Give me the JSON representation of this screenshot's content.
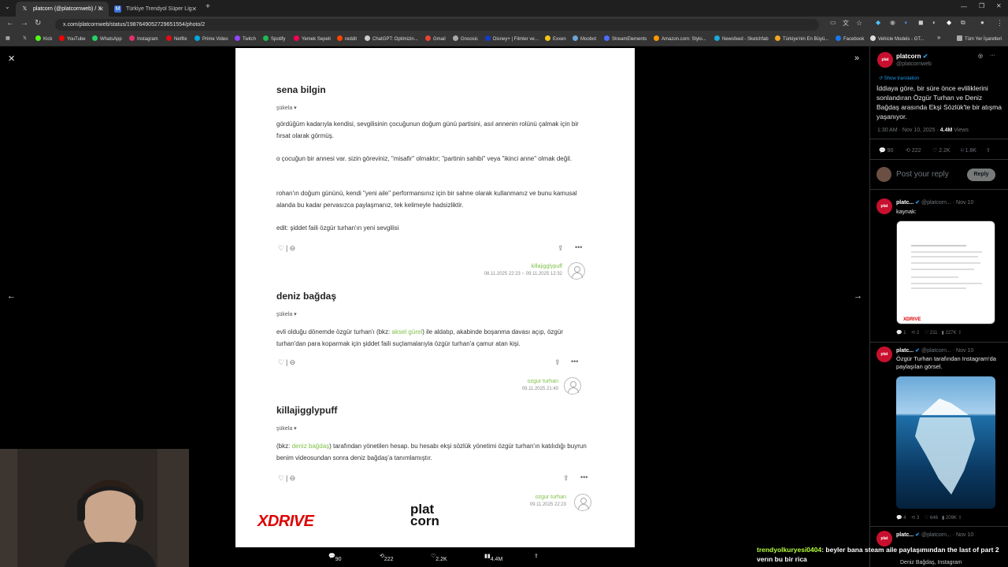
{
  "browser": {
    "tabs": [
      {
        "title": "platcorn (@platcornweb) / X",
        "active": true
      },
      {
        "title": "Türkiye Trendyol Süper Lig - 20",
        "active": false
      }
    ],
    "url": "x.com/platcornweb/status/1987649052729651554/photo/2",
    "bookmarks": [
      "Kick",
      "YouTube",
      "WhatsApp",
      "Instagram",
      "Netflix",
      "Prime Video",
      "Twitch",
      "Spotify",
      "Yemek Sepeti",
      "reddit",
      "ChatGPT: Optimizin...",
      "Gmail",
      "Gnoosic",
      "Disney+ | Filmler ve...",
      "Exxen",
      "Moobot",
      "StreamElements",
      "Amazon.com: Stylo...",
      "Newsfeed - Sketchfab",
      "Türkiye'nin En Büyü...",
      "Facebook",
      "Vehicle Models - GT..."
    ],
    "bookmarks_more": "»",
    "all_bookmarks": "Tüm Yer İşaretleri"
  },
  "entries": [
    {
      "title": "sena bilgin",
      "sukela": "şükela ▾",
      "paragraphs": [
        "gördüğüm kadarıyla kendisi, sevgilisinin çocuğunun doğum günü partisini, asıl annenin rolünü çalmak için bir fırsat olarak görmüş.",
        "o çocuğun bir annesi var. sizin göreviniz, \"misafir\" olmaktır; \"partinin sahibi\" veya \"ikinci anne\" olmak değil.",
        "rohan'ın doğum gününü, kendi \"yeni aile\" performansınız için bir sahne olarak kullanmanız ve bunu kamusal alanda bu kadar pervasızca paylaşmanız, tek kelimeyle hadsizliktir.",
        "edit: şiddet faili özgür turhan'ın yeni sevgilisi"
      ],
      "author": "killajigglypuff",
      "date": "08.11.2025 22:23 ~ 09.11.2025 12:32"
    },
    {
      "title": "deniz bağdaş",
      "sukela": "şükela ▾",
      "p1_pre": "evli olduğu dönemde özgür turhan'ı (bkz: ",
      "p1_link": "aksel gürel",
      "p1_post": ") ile aldatıp, akabinde boşanma davası açıp, özgür turhan'dan para koparmak için şiddet faili suçlamalarıyla özgür turhan'a çamur atan kişi.",
      "author": "ozgur turhan",
      "date": "09.11.2025 21:40"
    },
    {
      "title": "killajigglypuff",
      "sukela": "şükela ▾",
      "p1_pre": "(bkz: ",
      "p1_link": "deniz bağdaş",
      "p1_post": ") tarafından yönetilen hesap. bu hesabı ekşi sözlük yönetimi özgür turhan'ın katılıdığı buyrun benim videosundan sonra deniz bağdaş'a tanımlamıştır.",
      "author": "ozgur turhan",
      "date": "09.11.2025 22:23"
    }
  ],
  "logos": {
    "xdrive": "XDRIVE",
    "platcorn_1": "plat",
    "platcorn_2": "corn"
  },
  "viewer_bar": {
    "replies": "90",
    "reposts": "222",
    "likes": "2.2K",
    "views": "4.4M"
  },
  "tweet": {
    "name": "platcorn",
    "handle": "@platcornweb",
    "show_translation": "Show translation",
    "text": "İddiaya göre, bir süre önce evliliklerini sonlandıran Özgür Turhan ve Deniz Bağdaş arasında Ekşi Sözlük'te bir atışma yaşanıyor.",
    "time": "1:30 AM · Nov 10, 2025 ·",
    "views": "4.4M",
    "views_label": "Views",
    "replies": "90",
    "reposts": "222",
    "likes": "2.2K",
    "bookmarks": "1.8K",
    "reply_placeholder": "Post your reply",
    "reply_button": "Reply"
  },
  "replies": [
    {
      "name": "platc...",
      "handle": "@platcorn...",
      "date": "· Nov 10",
      "text": "kaynak:",
      "stats": {
        "replies": "1",
        "reposts": "2",
        "likes": "211",
        "views": "227K"
      }
    },
    {
      "name": "platc...",
      "handle": "@platcorn...",
      "date": "· Nov 10",
      "text": "Özgür Turhan tarafından Instagram'da paylaşılan görsel.",
      "stats": {
        "replies": "4",
        "reposts": "3",
        "likes": "646",
        "views": "209K"
      }
    },
    {
      "name": "platc...",
      "handle": "@platcorn...",
      "date": "· Nov 10",
      "text": "Deniz Bağdaş, Instagram"
    }
  ],
  "chat": {
    "user": "trendyolkuryesi0404",
    "message": ": beyler bana steam aile paylaşımından the last of part 2 verın bu bir rica"
  },
  "colors": {
    "link": "#81c14b",
    "accent": "#1d9bf0",
    "brand": "#c8102e"
  }
}
